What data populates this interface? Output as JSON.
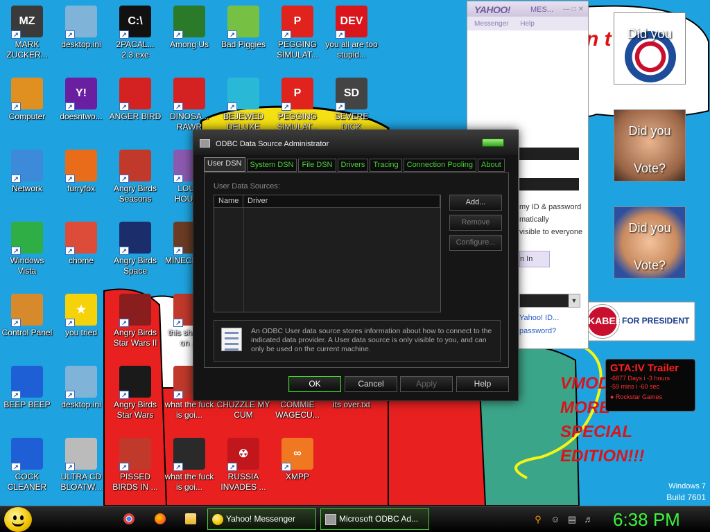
{
  "desktop": {
    "icons": [
      {
        "label": "MARK ZUCKER...",
        "color": "#3a3a3a",
        "glyph": "MZ"
      },
      {
        "label": "desktop.ini",
        "color": "#7fb3d8",
        "glyph": ""
      },
      {
        "label": "2PACAL... 2.3.exe",
        "color": "#111111",
        "glyph": "C:\\"
      },
      {
        "label": "Among Us",
        "color": "#2a7a2a",
        "glyph": ""
      },
      {
        "label": "Bad Piggies",
        "color": "#76c043",
        "glyph": ""
      },
      {
        "label": "PEGGING SIMULAT...",
        "color": "#e0231c",
        "glyph": "P"
      },
      {
        "label": "you all are too stupid...",
        "color": "#d9161c",
        "glyph": "DEV"
      },
      {
        "label": "Computer",
        "color": "#e09020",
        "glyph": ""
      },
      {
        "label": "doesntwo...",
        "color": "#6a1fa0",
        "glyph": "Y!"
      },
      {
        "label": "ANGER BIRD",
        "color": "#d42222",
        "glyph": ""
      },
      {
        "label": "DINOSA... RAWR",
        "color": "#d42222",
        "glyph": ""
      },
      {
        "label": "BEJEWED DELUXE",
        "color": "#29b8d6",
        "glyph": ""
      },
      {
        "label": "PEGGING SIMULAT...",
        "color": "#e0231c",
        "glyph": "P"
      },
      {
        "label": "SEVERE DICK",
        "color": "#444444",
        "glyph": "SD"
      },
      {
        "label": "Network",
        "color": "#3d8ad8",
        "glyph": ""
      },
      {
        "label": "furryfox",
        "color": "#e86c1a",
        "glyph": ""
      },
      {
        "label": "Angry Birds Seasons",
        "color": "#c0392b",
        "glyph": ""
      },
      {
        "label": "LOUD HOUSE",
        "color": "#8a5ab0",
        "glyph": ""
      },
      {
        "label": "Windows Vista",
        "color": "#2fae45",
        "glyph": ""
      },
      {
        "label": "chome",
        "color": "#dd4b39",
        "glyph": ""
      },
      {
        "label": "Angry Birds Space",
        "color": "#1b2e6b",
        "glyph": ""
      },
      {
        "label": "MINECRAFT",
        "color": "#6b3b23",
        "glyph": ""
      },
      {
        "label": "Control Panel",
        "color": "#d68a2c",
        "glyph": ""
      },
      {
        "label": "you tried",
        "color": "#f6d20a",
        "glyph": "★"
      },
      {
        "label": "Angry Birds Star Wars II",
        "color": "#8a1d1d",
        "glyph": ""
      },
      {
        "label": "this sh... be on ...",
        "color": "#c0392b",
        "glyph": ""
      },
      {
        "label": "BEEP BEEP",
        "color": "#1e5fd6",
        "glyph": ""
      },
      {
        "label": "desktop.ini",
        "color": "#7fb3d8",
        "glyph": ""
      },
      {
        "label": "Angry Birds Star Wars",
        "color": "#1a1a1a",
        "glyph": ""
      },
      {
        "label": "what the fuck is goi...",
        "color": "#c0392b",
        "glyph": ""
      },
      {
        "label": "CHUZZLE MY CUM",
        "color": "#d89020",
        "glyph": ""
      },
      {
        "label": "COMMIE WAGECU...",
        "color": "#c71c1c",
        "glyph": ""
      },
      {
        "label": "its over.txt",
        "color": "#dddddd",
        "glyph": ""
      },
      {
        "label": "COCK CLEANER",
        "color": "#1e5fd6",
        "glyph": ""
      },
      {
        "label": "ULTRA CD BLOATW...",
        "color": "#bbbbbb",
        "glyph": ""
      },
      {
        "label": "PISSED BIRDS IN ...",
        "color": "#c0392b",
        "glyph": ""
      },
      {
        "label": "what the fuck is goi...",
        "color": "#2a2a2a",
        "glyph": ""
      },
      {
        "label": "RUSSIA INVADES ...",
        "color": "#c0161c",
        "glyph": "☢"
      },
      {
        "label": "XMPP",
        "color": "#f07820",
        "glyph": "∞"
      }
    ]
  },
  "odbc": {
    "title": "ODBC Data Source Administrator",
    "tabs": [
      "User DSN",
      "System DSN",
      "File DSN",
      "Drivers",
      "Tracing",
      "Connection Pooling",
      "About"
    ],
    "section_label": "User Data Sources:",
    "columns": [
      "Name",
      "Driver"
    ],
    "buttons": {
      "add": "Add...",
      "remove": "Remove",
      "configure": "Configure..."
    },
    "info": "An ODBC User data source stores information about how to connect to the indicated data provider.   A User data source is only visible to you, and can only be used on the current machine.",
    "footer": {
      "ok": "OK",
      "cancel": "Cancel",
      "apply": "Apply",
      "help": "Help"
    }
  },
  "yahoo": {
    "logo": "YAHOO!",
    "title_suffix": "MES...",
    "menu": [
      "Messenger",
      "Help"
    ],
    "remember": "my ID & password",
    "auto": "matically",
    "invisible": "visible to everyone",
    "signin": "n In",
    "forgot_id": "Yahoo! ID...",
    "forgot_pw": "password?"
  },
  "posters": {
    "obama_top": "Did you",
    "mccain_top": "Did you",
    "mccain_bottom": "Vote?",
    "hillary_top": "Did you",
    "hillary_bottom": "Vote?",
    "huckabee": "KABEE",
    "huckabee_sub": "FOR PRESIDENT"
  },
  "wallpaper_text": {
    "speech": "n t",
    "vmod": [
      "VMOD",
      "MORE",
      "SPECIAL",
      "EDITION!!!"
    ]
  },
  "gta": {
    "title": "GTA:IV Trailer",
    "line1": "-6877 Days i -3 hours",
    "line2": "-59 mins i -60 sec",
    "brand": "● Rockstar Games"
  },
  "windows_badge": {
    "name": "Windows 7",
    "build": "Build 7601"
  },
  "taskbar": {
    "yahoo_button": "Yahoo! Messenger",
    "odbc_button": "Microsoft ODBC Ad...",
    "clock": "6:38 PM"
  }
}
